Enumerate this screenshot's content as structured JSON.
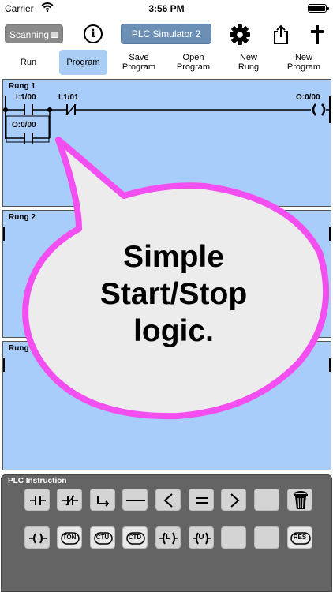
{
  "status_bar": {
    "carrier": "Carrier",
    "time": "3:56 PM"
  },
  "toolbar": {
    "scan_label": "Scanning",
    "info_label": "i",
    "title": "PLC Simulator 2"
  },
  "modes": [
    {
      "line1": "Run",
      "line2": ""
    },
    {
      "line1": "Program",
      "line2": ""
    },
    {
      "line1": "Save",
      "line2": "Program"
    },
    {
      "line1": "Open",
      "line2": "Program"
    },
    {
      "line1": "New",
      "line2": "Rung"
    },
    {
      "line1": "New",
      "line2": "Program"
    }
  ],
  "rungs": [
    {
      "label": "Rung 1"
    },
    {
      "label": "Rung 2"
    },
    {
      "label": "Rung 3"
    }
  ],
  "rung1": {
    "contact1_tag": "I:1/00",
    "contact2_tag": "I:1/01",
    "coil_tag": "O:0/00",
    "branch_tag": "O:0/00"
  },
  "callout": {
    "line1": "Simple",
    "line2": "Start/Stop",
    "line3": "logic.",
    "border_color": "#f34ff0",
    "fill_color": "#ececec"
  },
  "instructions": {
    "title": "PLC Instruction",
    "row2": {
      "ton": "TON",
      "ctu": "CTU",
      "ctd": "CTD",
      "latch": "L",
      "unlatch": "U",
      "res": "RES"
    }
  }
}
